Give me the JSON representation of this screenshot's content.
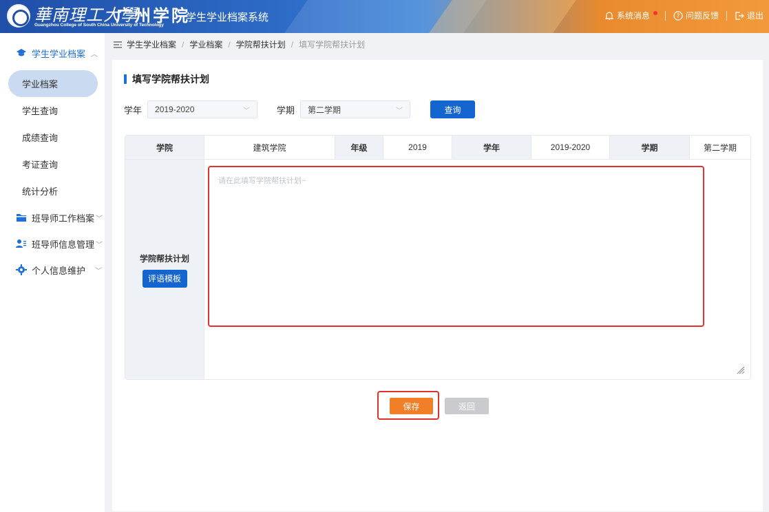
{
  "header": {
    "logo_calligraphy": "華南理工大學",
    "logo_name": "广州学院",
    "logo_english": "Guangzhou College of South China University of Technology",
    "system_title": "学生学业档案系统",
    "messages_label": "系统消息",
    "feedback_label": "问题反馈",
    "logout_label": "退出"
  },
  "sidebar": {
    "groups": [
      {
        "label": "学生学业档案",
        "icon": "graduation-cap-icon",
        "expanded": true
      },
      {
        "label": "班导师工作档案",
        "icon": "folder-icon",
        "expanded": false
      },
      {
        "label": "班导师信息管理",
        "icon": "user-list-icon",
        "expanded": false
      },
      {
        "label": "个人信息维护",
        "icon": "gear-icon",
        "expanded": false
      }
    ],
    "items": [
      {
        "label": "学业档案",
        "active": true
      },
      {
        "label": "学生查询",
        "active": false
      },
      {
        "label": "成绩查询",
        "active": false
      },
      {
        "label": "考证查询",
        "active": false
      },
      {
        "label": "统计分析",
        "active": false
      }
    ]
  },
  "breadcrumb": {
    "items": [
      "学生学业档案",
      "学业档案",
      "学院帮扶计划"
    ],
    "current": "填写学院帮扶计划"
  },
  "page": {
    "title": "填写学院帮扶计划"
  },
  "filters": {
    "year_label": "学年",
    "year_value": "2019-2020",
    "term_label": "学期",
    "term_value": "第二学期",
    "query_label": "查询"
  },
  "table": {
    "header": [
      {
        "label": "学院",
        "value": "建筑学院"
      },
      {
        "label": "年级",
        "value": "2019"
      },
      {
        "label": "学年",
        "value": "2019-2020"
      },
      {
        "label": "学期",
        "value": "第二学期"
      }
    ],
    "row_label": "学院帮扶计划",
    "template_button": "评语模板",
    "textarea_placeholder": "请在此填写学院帮扶计划~"
  },
  "actions": {
    "save_label": "保存",
    "back_label": "返回"
  },
  "colors": {
    "primary": "#1565d1",
    "save": "#f07f28",
    "highlight": "#e0322a",
    "active_nav": "#c9daf1"
  }
}
